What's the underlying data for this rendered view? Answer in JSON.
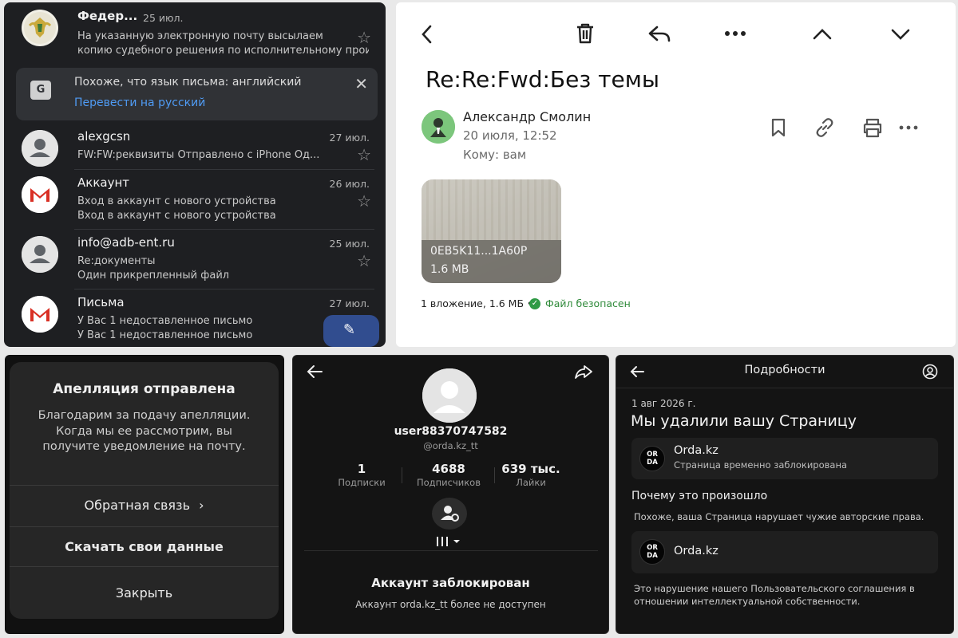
{
  "mail_list": {
    "rows": [
      {
        "sender": "Федер...",
        "date": "25 июл.",
        "line1": "На указанную электронную почту высылаем",
        "line2": "копию судебного решения по исполнительному произво..."
      },
      {
        "sender": "alexgcsn",
        "date": "27 июл.",
        "line1": "FW:FW:реквизиты Отправлено с iPhone Од...",
        "line2": ""
      },
      {
        "sender": "Аккаунт",
        "date": "26 июл.",
        "line1": "Вход в аккаунт с нового устройства",
        "line2": "Вход в аккаунт с нового устройства"
      },
      {
        "sender": "info@adb-ent.ru",
        "date": "25 июл.",
        "line1": "Re:документы",
        "line2": "Один прикрепленный файл"
      },
      {
        "sender": "Письма",
        "date": "27 июл.",
        "line1": "У Вас 1 недоставленное письмо",
        "line2": "У Вас 1 недоставленное письмо"
      }
    ],
    "translate_banner": {
      "text": "Похоже, что язык письма: английский",
      "link": "Перевести на русский"
    }
  },
  "email_detail": {
    "subject": "Re:Re:Fwd:Без темы",
    "sender_name": "Александр Смолин",
    "sent_date": "20 июля, 12:52",
    "to": "Кому: вам",
    "attachment": {
      "name": "0EB5K11...1A60P",
      "size": "1.6 MB"
    },
    "attachment_info": "1 вложение, 1.6 МБ •",
    "safe_label": "Файл безопасен"
  },
  "appeal": {
    "title": "Апелляция отправлена",
    "body": "Благодарим за подачу апелляции. Когда мы ее рассмотрим, вы получите уведомление на почту.",
    "feedback": "Обратная связь",
    "download": "Скачать свои данные",
    "close": "Закрыть"
  },
  "profile": {
    "username": "user88370747582",
    "handle": "@orda.kz_tt",
    "stats": [
      {
        "value": "1",
        "label": "Подписки"
      },
      {
        "value": "4688",
        "label": "Подписчиков"
      },
      {
        "value": "639 тыс.",
        "label": "Лайки"
      }
    ],
    "blocked_title": "Аккаунт заблокирован",
    "blocked_sub": "Аккаунт orda.kz_tt более не доступен"
  },
  "details": {
    "header": "Подробности",
    "date": "1 авг 2026 г.",
    "headline": "Мы удалили вашу Страницу",
    "page_name": "Orda.kz",
    "page_status": "Страница временно заблокирована",
    "logo_text": "OR DA",
    "why_title": "Почему это произошло",
    "why_text": "Похоже, ваша Страница нарушает чужие авторские права.",
    "page_name_2": "Orda.kz",
    "footer": "Это нарушение нашего Пользовательского соглашения в отношении интеллектуальной собственности."
  }
}
